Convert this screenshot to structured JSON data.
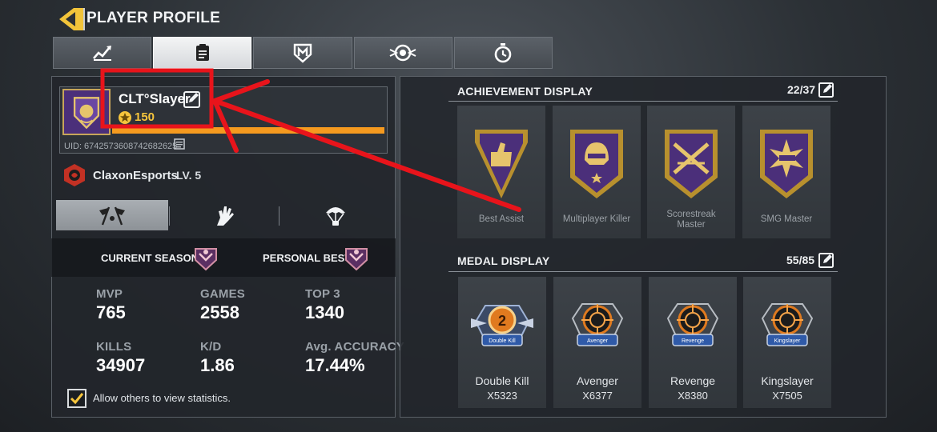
{
  "header": {
    "title": "PLAYER PROFILE"
  },
  "tabs": [
    {
      "icon": "stats-graph-icon"
    },
    {
      "icon": "clipboard-icon",
      "active": true
    },
    {
      "icon": "shield-emblem-icon"
    },
    {
      "icon": "gear-badge-icon"
    },
    {
      "icon": "stopwatch-icon"
    }
  ],
  "profile": {
    "name": "CLT°Slayer",
    "coins": "150",
    "uid": "UID: 6742573608742682625",
    "clan": {
      "name": "ClaxonEsports",
      "level": "LV. 5"
    },
    "xp_progress": 0.9
  },
  "subtabs": [
    {
      "icon": "flags-icon",
      "active": true
    },
    {
      "icon": "glove-icon"
    },
    {
      "icon": "parachute-icon"
    }
  ],
  "stats": {
    "current_season_label": "CURRENT SEASON |",
    "personal_best_label": "PERSONAL BEST |",
    "items": [
      {
        "label": "MVP",
        "value": "765"
      },
      {
        "label": "GAMES",
        "value": "2558"
      },
      {
        "label": "TOP 3",
        "value": "1340"
      },
      {
        "label": "KILLS",
        "value": "34907"
      },
      {
        "label": "K/D",
        "value": "1.86"
      },
      {
        "label": "Avg. ACCURACY",
        "value": "17.44%"
      }
    ],
    "allow_text": "Allow others to view statistics.",
    "allow_checked": true
  },
  "achievements": {
    "title": "ACHIEVEMENT DISPLAY",
    "count": "22/37",
    "items": [
      {
        "label": "Best Assist",
        "icon": "thumbs-up-icon"
      },
      {
        "label": "Multiplayer Killer",
        "icon": "helmet-icon"
      },
      {
        "label": "Scorestreak Master",
        "label_lines": [
          "Scorestreak",
          "Master"
        ],
        "icon": "crossed-jets-icon"
      },
      {
        "label": "SMG Master",
        "icon": "smg-burst-icon"
      }
    ]
  },
  "medals": {
    "title": "MEDAL DISPLAY",
    "count": "55/85",
    "items": [
      {
        "name": "Double Kill",
        "badge": "Double Kill",
        "count": "X5323",
        "icon": "number-two-icon"
      },
      {
        "name": "Avenger",
        "badge": "Avenger",
        "count": "X6377",
        "icon": "crosshair-icon"
      },
      {
        "name": "Revenge",
        "badge": "Revenge",
        "count": "X8380",
        "icon": "crosshair-icon"
      },
      {
        "name": "Kingslayer",
        "badge": "Kingslayer",
        "count": "X7505",
        "icon": "crosshair-icon"
      }
    ]
  },
  "colors": {
    "accent_gold": "#f6c53c",
    "xp_bar": "#f59a1f",
    "annotation_red": "#e8141b",
    "emblem_purple": "#4b2f7a"
  }
}
